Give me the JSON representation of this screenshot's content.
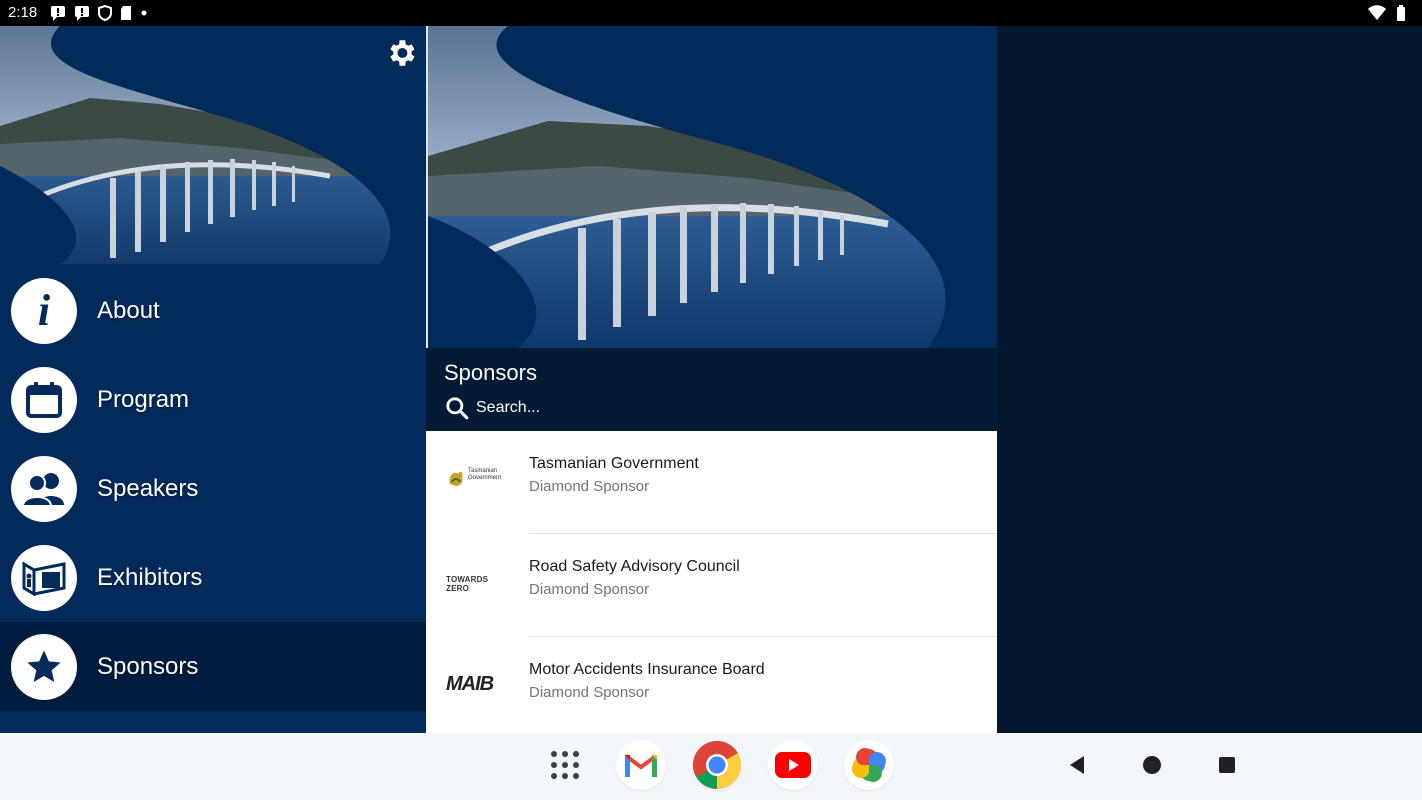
{
  "status_bar": {
    "time": "2:18"
  },
  "drawer": {
    "settings_icon": "gear-icon",
    "items": [
      {
        "label": "About",
        "icon": "info-icon",
        "active": false
      },
      {
        "label": "Program",
        "icon": "calendar-icon",
        "active": false
      },
      {
        "label": "Speakers",
        "icon": "people-icon",
        "active": false
      },
      {
        "label": "Exhibitors",
        "icon": "exhibitor-booth-icon",
        "active": false
      },
      {
        "label": "Sponsors",
        "icon": "star-icon",
        "active": true
      }
    ]
  },
  "content": {
    "title": "Sponsors",
    "search": {
      "placeholder": "Search..."
    },
    "sponsors": [
      {
        "name": "Tasmanian Government",
        "tier": "Diamond Sponsor",
        "logo_text": "Tasmanian Government"
      },
      {
        "name": "Road Safety Advisory Council",
        "tier": "Diamond Sponsor",
        "logo_text": "TOWARDS ZERO"
      },
      {
        "name": "Motor Accidents Insurance Board",
        "tier": "Diamond Sponsor",
        "logo_text": "MAIB"
      }
    ]
  },
  "taskbar": {
    "apps": [
      "app-drawer-icon",
      "gmail-icon",
      "chrome-icon",
      "youtube-icon",
      "photos-icon"
    ],
    "nav": [
      "back-icon",
      "home-icon",
      "recents-icon"
    ]
  },
  "colors": {
    "drawer_bg": "#022a5a",
    "active_item_bg": "#001c3e",
    "header_bg": "#031a34"
  }
}
